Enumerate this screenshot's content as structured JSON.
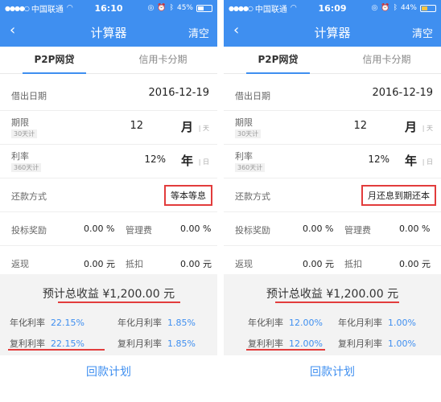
{
  "left": {
    "status": {
      "carrier": "中国联通",
      "time": "16:10",
      "battery": "45%",
      "battery_fraction": 0.45
    },
    "nav": {
      "title": "计算器",
      "clear": "清空"
    },
    "tabs": [
      "P2P网贷",
      "信用卡分期"
    ],
    "loan_date": {
      "label": "借出日期",
      "value": "2016-12-19"
    },
    "term": {
      "label": "期限",
      "sub": "30天计",
      "value": "12",
      "unit": "月",
      "alt_unit": "天"
    },
    "rate": {
      "label": "利率",
      "sub": "360天计",
      "value": "12",
      "percent": "%",
      "unit": "年",
      "alt_unit": "日"
    },
    "repay": {
      "label": "还款方式",
      "value": "等本等息"
    },
    "bonus": {
      "label": "投标奖励",
      "value": "0.00 %",
      "label2": "管理费",
      "value2": "0.00 %"
    },
    "cashback": {
      "label": "返现",
      "value": "0.00 元",
      "label2": "抵扣",
      "value2": "0.00 元"
    },
    "summary": {
      "total": "预计总收益  ¥1,200.00 元",
      "annual_label": "年化利率",
      "annual_value": "22.15%",
      "annual_month_label": "年化月利率",
      "annual_month_value": "1.85%",
      "compound_label": "复利利率",
      "compound_value": "22.15%",
      "compound_month_label": "复利月利率",
      "compound_month_value": "1.85%"
    },
    "plan": "回款计划"
  },
  "right": {
    "status": {
      "carrier": "中国联通",
      "time": "16:09",
      "battery": "44%",
      "battery_fraction": 0.44
    },
    "nav": {
      "title": "计算器",
      "clear": "清空"
    },
    "tabs": [
      "P2P网贷",
      "信用卡分期"
    ],
    "loan_date": {
      "label": "借出日期",
      "value": "2016-12-19"
    },
    "term": {
      "label": "期限",
      "sub": "30天计",
      "value": "12",
      "unit": "月",
      "alt_unit": "天"
    },
    "rate": {
      "label": "利率",
      "sub": "360天计",
      "value": "12",
      "percent": "%",
      "unit": "年",
      "alt_unit": "日"
    },
    "repay": {
      "label": "还款方式",
      "value": "月还息到期还本"
    },
    "bonus": {
      "label": "投标奖励",
      "value": "0.00 %",
      "label2": "管理费",
      "value2": "0.00 %"
    },
    "cashback": {
      "label": "返现",
      "value": "0.00 元",
      "label2": "抵扣",
      "value2": "0.00 元"
    },
    "summary": {
      "total": "预计总收益  ¥1,200.00 元",
      "annual_label": "年化利率",
      "annual_value": "12.00%",
      "annual_month_label": "年化月利率",
      "annual_month_value": "1.00%",
      "compound_label": "复利利率",
      "compound_value": "12.00%",
      "compound_month_label": "复利月利率",
      "compound_month_value": "1.00%"
    },
    "plan": "回款计划"
  },
  "colors": {
    "primary": "#3f8ff0",
    "highlight": "#e23c3c",
    "battery_low": "#f6c342"
  }
}
